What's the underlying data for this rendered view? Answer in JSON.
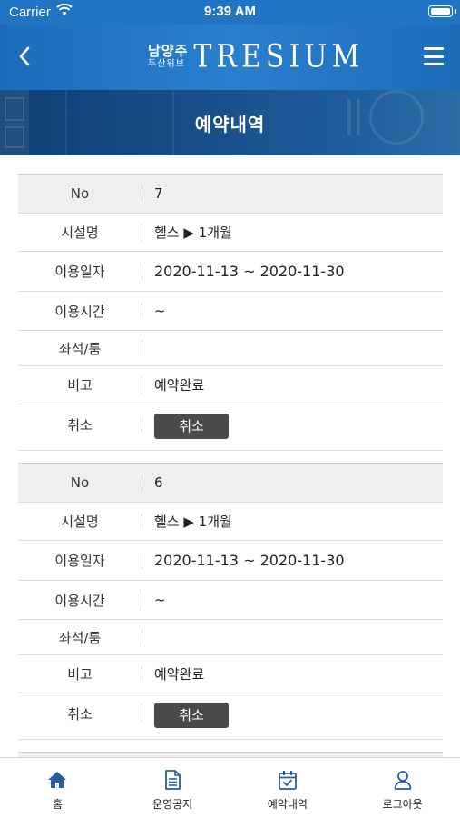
{
  "status_bar": {
    "carrier": "Carrier",
    "time": "9:39 AM"
  },
  "header": {
    "logo_ko_main": "남양주",
    "logo_ko_sub": "두산위브",
    "logo_brand": "TRESIUM"
  },
  "banner": {
    "title": "예약내역"
  },
  "records": [
    {
      "no": "7",
      "facility": "헬스 ▶ 1개월",
      "use_date": "2020-11-13 ~ 2020-11-30",
      "use_time": "~",
      "seat_room": "",
      "note": "예약완료",
      "cancel_label": "취소"
    },
    {
      "no": "6",
      "facility": "헬스 ▶ 1개월",
      "use_date": "2020-11-13 ~ 2020-11-30",
      "use_time": "~",
      "seat_room": "",
      "note": "예약완료",
      "cancel_label": "취소"
    }
  ],
  "labels": {
    "no": "No",
    "facility": "시설명",
    "use_date": "이용일자",
    "use_time": "이용시간",
    "seat_room": "좌석/룸",
    "note": "비고",
    "cancel": "취소"
  },
  "tabs": [
    {
      "label": "홈",
      "icon": "home-icon"
    },
    {
      "label": "운영공지",
      "icon": "document-icon"
    },
    {
      "label": "예약내역",
      "icon": "calendar-check-icon"
    },
    {
      "label": "로그아웃",
      "icon": "person-icon"
    }
  ],
  "colors": {
    "accent": "#1f74c4",
    "tab_icon": "#2a5d9e",
    "button": "#4a4a4a"
  }
}
